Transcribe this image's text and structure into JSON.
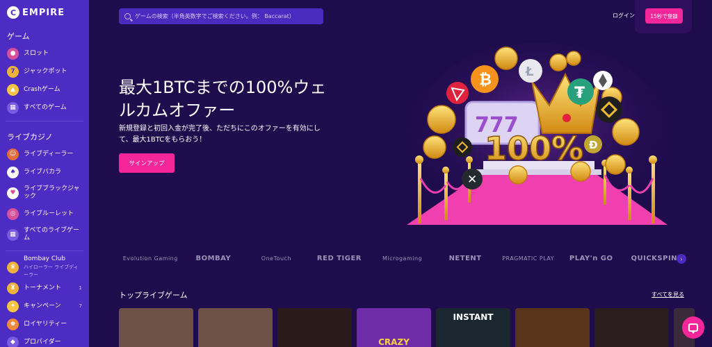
{
  "brand": {
    "name": "EMPIRE",
    "mark": "C"
  },
  "sidebar": {
    "games_title": "ゲーム",
    "games": [
      {
        "label": "スロット",
        "icon": "cherry-icon"
      },
      {
        "label": "ジャックポット",
        "icon": "seven-icon"
      },
      {
        "label": "Crashゲーム",
        "icon": "rocket-icon"
      },
      {
        "label": "すべてのゲーム",
        "icon": "grid-icon"
      }
    ],
    "live_title": "ライブカジノ",
    "live": [
      {
        "label": "ライブディーラー",
        "icon": "dealer-icon"
      },
      {
        "label": "ライブバカラ",
        "icon": "baccarat-icon"
      },
      {
        "label": "ライブブラックジャック",
        "icon": "blackjack-icon"
      },
      {
        "label": "ライブルーレット",
        "icon": "roulette-icon"
      },
      {
        "label": "すべてのライブゲーム",
        "icon": "live-grid-icon"
      }
    ],
    "bombay": {
      "label": "Bombay Club",
      "sub": "ハイローラー ライブディーラー"
    },
    "tournament": {
      "label": "トーナメント",
      "count": "1"
    },
    "campaign": {
      "label": "キャンペーン",
      "count": "7"
    },
    "loyalty": {
      "label": "ロイヤリティー"
    },
    "providers": {
      "label": "プロバイダー"
    }
  },
  "header": {
    "search_placeholder": "ゲームの検索（半角英数字でご検索ください。例： Baccarat）",
    "login": "ログイン",
    "register": "15秒で登録"
  },
  "hero": {
    "title": "最大1BTCまでの100%ウェルカムオファー",
    "description": "新規登録と初回入金が完了後、ただちにこのオファーを有効にして、最大1BTCをもらおう！",
    "cta": "サインアップ",
    "art_label": "100%"
  },
  "providers": [
    "Evolution Gaming",
    "BOMBAY",
    "OneTouch",
    "RED TIGER",
    "Microgaming",
    "NETENT",
    "PRAGMATIC PLAY",
    "PLAY'n GO",
    "QUICKSPIN"
  ],
  "top_live": {
    "title": "トップライブゲーム",
    "see_all": "すべてを見る",
    "tiles": [
      {
        "text": "",
        "color": "#6e5247"
      },
      {
        "text": "",
        "color": "#6e5247"
      },
      {
        "text": "",
        "color": "#2b1a1a"
      },
      {
        "text": "CRAZY",
        "color": "#6f2ca8"
      },
      {
        "text": "INSTANT",
        "color": "#1a2630"
      },
      {
        "text": "",
        "color": "#5a3418"
      },
      {
        "text": "",
        "color": "#2a1d1d"
      },
      {
        "text": "",
        "color": "#3a2a3a"
      }
    ]
  },
  "colors": {
    "sidebar": "#4d2cc4",
    "background": "#1f0c4d",
    "accent": "#f5259a"
  }
}
